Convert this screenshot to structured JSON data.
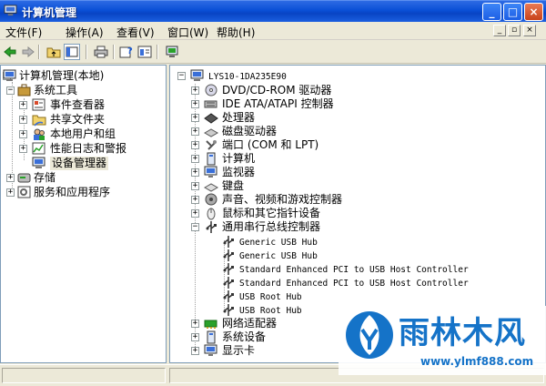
{
  "window": {
    "title": "计算机管理"
  },
  "title_buttons": {
    "minimize": "_",
    "maximize": "□",
    "close": "×"
  },
  "menu": [
    "文件(F)",
    "操作(A)",
    "查看(V)",
    "窗口(W)",
    "帮助(H)"
  ],
  "mdi_buttons": [
    "_",
    "▫",
    "×"
  ],
  "toolbar_icons": [
    "back-icon",
    "forward-icon",
    "up-folder-icon",
    "show-hide-tree-icon",
    "print-icon",
    "help-icon",
    "properties-icon",
    "update-driver-icon"
  ],
  "left_tree": {
    "root": "计算机管理(本地)",
    "system_tools": "系统工具",
    "event_viewer": "事件查看器",
    "shared_folders": "共享文件夹",
    "local_users": "本地用户和组",
    "perf_logs": "性能日志和警报",
    "device_manager": "设备管理器",
    "storage": "存储",
    "services": "服务和应用程序"
  },
  "right_tree": {
    "computer": "LYS10-1DA235E90",
    "dvd": "DVD/CD-ROM 驱动器",
    "ide": "IDE ATA/ATAPI 控制器",
    "cpu": "处理器",
    "disk": "磁盘驱动器",
    "ports": "端口 (COM 和 LPT)",
    "computer_node": "计算机",
    "monitor": "监视器",
    "keyboard": "键盘",
    "sound": "声音、视频和游戏控制器",
    "mouse": "鼠标和其它指针设备",
    "usb": "通用串行总线控制器",
    "usb_items": [
      "Generic USB Hub",
      "Generic USB Hub",
      "Standard Enhanced PCI to USB Host Controller",
      "Standard Enhanced PCI to USB Host Controller",
      "USB Root Hub",
      "USB Root Hub"
    ],
    "network": "网络适配器",
    "system": "系统设备",
    "display": "显示卡"
  },
  "watermark": {
    "brand": "雨林木风",
    "url": "www.ylmf888.com"
  },
  "colors": {
    "title_blue": "#0a4fd6",
    "watermark_blue": "#1573c8",
    "close_red": "#c8421a"
  }
}
